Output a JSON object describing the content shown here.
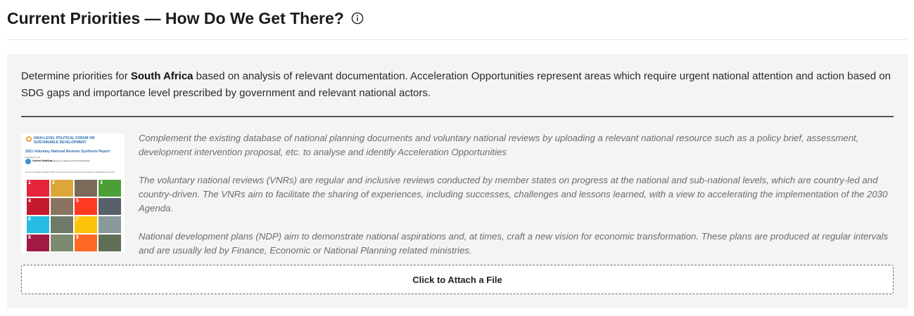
{
  "header": {
    "title": "Current Priorities — How Do We Get There?",
    "info_icon": "info-circle-icon"
  },
  "intro": {
    "prefix": "Determine priorities for ",
    "country": "South Africa",
    "suffix": " based on analysis of relevant documentation. Acceleration Opportunities represent areas which require urgent national attention and action based on SDG gaps and importance level prescribed by government and relevant national actors."
  },
  "thumbnail": {
    "forum_title": "HIGH-LEVEL POLITICAL FORUM ON SUSTAINABLE DEVELOPMENT",
    "report_title": "2021 Voluntary National Reviews Synthesis Report",
    "prepared_by": "Prepared by the",
    "org_name": "United Nations",
    "org_dept": "Department of Economic and Social Affairs",
    "credit": "with the coordination of DESA's Office of Intergovernmental Support and Coordination for Sustainable Development",
    "tiles": [
      {
        "num": "1",
        "color": "#e5243b"
      },
      {
        "num": "2",
        "color": "#dda63a"
      },
      {
        "num": "",
        "color": "#7a6a5a"
      },
      {
        "num": "3",
        "color": "#4c9f38"
      },
      {
        "num": "4",
        "color": "#c5192d"
      },
      {
        "num": "",
        "color": "#8a7360"
      },
      {
        "num": "5",
        "color": "#ff3a21"
      },
      {
        "num": "",
        "color": "#56606a"
      },
      {
        "num": "6",
        "color": "#26bde2"
      },
      {
        "num": "",
        "color": "#6f7a68"
      },
      {
        "num": "7",
        "color": "#fcc30b"
      },
      {
        "num": "",
        "color": "#8a9a9a"
      },
      {
        "num": "8",
        "color": "#a21942"
      },
      {
        "num": "",
        "color": "#7b8a70"
      },
      {
        "num": "9",
        "color": "#fd6925"
      },
      {
        "num": "",
        "color": "#5f6f55"
      }
    ]
  },
  "descriptions": [
    "Complement the existing database of national planning documents and voluntary national reviews by uploading a relevant national resource such as a policy brief, assessment, development intervention proposal, etc. to analyse and identify Acceleration Opportunities",
    "The voluntary national reviews (VNRs) are regular and inclusive reviews conducted by member states on progress at the national and sub-national levels, which are country-led and country-driven. The VNRs aim to facilitate the sharing of experiences, including successes, challenges and lessons learned, with a view to accelerating the implementation of the 2030 Agenda.",
    "National development plans (NDP) aim to demonstrate national aspirations and, at times, craft a new vision for economic transformation. These plans are produced at regular intervals and are usually led by Finance, Economic or National Planning related ministries."
  ],
  "attach_button": {
    "label": "Click to Attach a File"
  }
}
